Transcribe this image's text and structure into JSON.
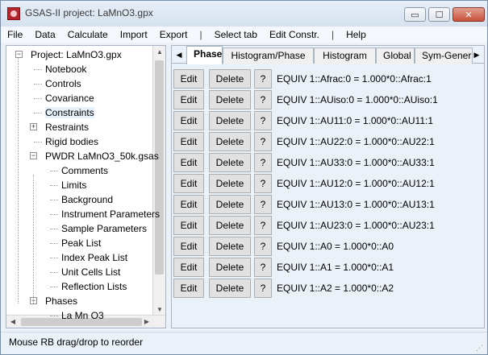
{
  "window": {
    "title": "GSAS-II project: LaMnO3.gpx",
    "min_glyph": "▭",
    "max_glyph": "☐",
    "close_glyph": "✕"
  },
  "menu": [
    "File",
    "Data",
    "Calculate",
    "Import",
    "Export",
    "|",
    "Select tab",
    "Edit Constr.",
    "|",
    "Help"
  ],
  "tree": {
    "items": [
      {
        "label": "Project: LaMnO3.gpx",
        "level": 0,
        "expander": "−"
      },
      {
        "label": "Notebook",
        "level": 1
      },
      {
        "label": "Controls",
        "level": 1
      },
      {
        "label": "Covariance",
        "level": 1
      },
      {
        "label": "Constraints",
        "level": 1,
        "selected": true
      },
      {
        "label": "Restraints",
        "level": 1,
        "expander": "+"
      },
      {
        "label": "Rigid bodies",
        "level": 1
      },
      {
        "label": "PWDR LaMnO3_50k.gsas",
        "level": 1,
        "expander": "−"
      },
      {
        "label": "Comments",
        "level": 2
      },
      {
        "label": "Limits",
        "level": 2
      },
      {
        "label": "Background",
        "level": 2
      },
      {
        "label": "Instrument Parameters",
        "level": 2
      },
      {
        "label": "Sample Parameters",
        "level": 2
      },
      {
        "label": "Peak List",
        "level": 2
      },
      {
        "label": "Index Peak List",
        "level": 2
      },
      {
        "label": "Unit Cells List",
        "level": 2
      },
      {
        "label": "Reflection Lists",
        "level": 2
      },
      {
        "label": "Phases",
        "level": 1,
        "expander": "−"
      },
      {
        "label": "La Mn O3",
        "level": 2
      }
    ]
  },
  "tabs": [
    {
      "label": "Phase",
      "active": true
    },
    {
      "label": "Histogram/Phase"
    },
    {
      "label": "Histogram"
    },
    {
      "label": "Global"
    },
    {
      "label": "Sym-Gener"
    }
  ],
  "constraints": {
    "edit_label": "Edit",
    "delete_label": "Delete",
    "help_label": "?",
    "rows": [
      "EQUIV 1::Afrac:0  = 1.000*0::Afrac:1",
      "EQUIV 1::AUiso:0  = 1.000*0::AUiso:1",
      "EQUIV 1::AU11:0  = 1.000*0::AU11:1",
      "EQUIV 1::AU22:0  = 1.000*0::AU22:1",
      "EQUIV 1::AU33:0  = 1.000*0::AU33:1",
      "EQUIV 1::AU12:0  = 1.000*0::AU12:1",
      "EQUIV 1::AU13:0  = 1.000*0::AU13:1",
      "EQUIV 1::AU23:0  = 1.000*0::AU23:1",
      "EQUIV 1::A0  = 1.000*0::A0",
      "EQUIV 1::A1  = 1.000*0::A1",
      "EQUIV 1::A2  = 1.000*0::A2"
    ]
  },
  "status": {
    "text": "Mouse RB drag/drop to reorder"
  }
}
